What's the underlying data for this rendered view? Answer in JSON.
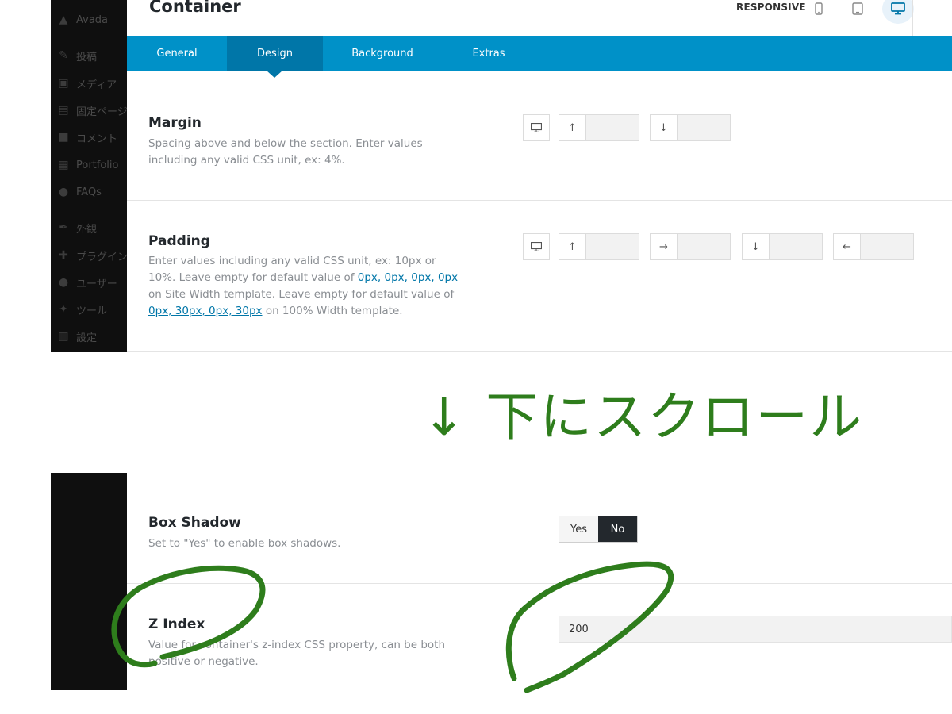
{
  "sidebar": {
    "items": [
      {
        "label": "Avada",
        "icon": "avada-logo-icon"
      },
      {
        "label": "投稿",
        "icon": "pin-icon"
      },
      {
        "label": "メディア",
        "icon": "media-icon"
      },
      {
        "label": "固定ページ",
        "icon": "pages-icon"
      },
      {
        "label": "コメント",
        "icon": "comment-icon"
      },
      {
        "label": "Portfolio",
        "icon": "portfolio-icon"
      },
      {
        "label": "FAQs",
        "icon": "faq-icon"
      },
      {
        "label": "外観",
        "icon": "brush-icon"
      },
      {
        "label": "プラグイン",
        "icon": "plugin-icon"
      },
      {
        "label": "ユーザー",
        "icon": "user-icon"
      },
      {
        "label": "ツール",
        "icon": "wrench-icon"
      },
      {
        "label": "設定",
        "icon": "settings-icon"
      }
    ]
  },
  "header": {
    "title": "Container",
    "responsive_label": "RESPONSIVE",
    "devices": [
      "mobile-icon",
      "tablet-icon",
      "desktop-icon"
    ],
    "active_device": "desktop"
  },
  "tabs": [
    {
      "label": "General"
    },
    {
      "label": "Design"
    },
    {
      "label": "Background"
    },
    {
      "label": "Extras"
    }
  ],
  "active_tab": "Design",
  "margin": {
    "title": "Margin",
    "description": "Spacing above and below the section. Enter values including any valid CSS unit, ex: 4%.",
    "top_value": "",
    "bottom_value": ""
  },
  "padding": {
    "title": "Padding",
    "description_part1": "Enter values including any valid CSS unit, ex: 10px or 10%. Leave empty for default value of ",
    "link1": "0px, 0px, 0px, 0px",
    "description_part2": " on Site Width template. Leave empty for default value of ",
    "link2": "0px, 30px, 0px, 30px",
    "description_part3": " on 100% Width template.",
    "top_value": "",
    "right_value": "",
    "bottom_value": "",
    "left_value": ""
  },
  "scroll_note": "↓ 下にスクロール",
  "box_shadow": {
    "title": "Box Shadow",
    "description": "Set to \"Yes\" to enable box shadows.",
    "yes_label": "Yes",
    "no_label": "No",
    "selected": "No"
  },
  "z_index": {
    "title": "Z Index",
    "description": "Value for container's z-index CSS property, can be both positive or negative.",
    "value": "200"
  },
  "colors": {
    "tab_bar": "#0091c8",
    "tab_active": "#0076a8",
    "annotation_green": "#2e7d1c",
    "toggle_selected": "#23282d"
  }
}
